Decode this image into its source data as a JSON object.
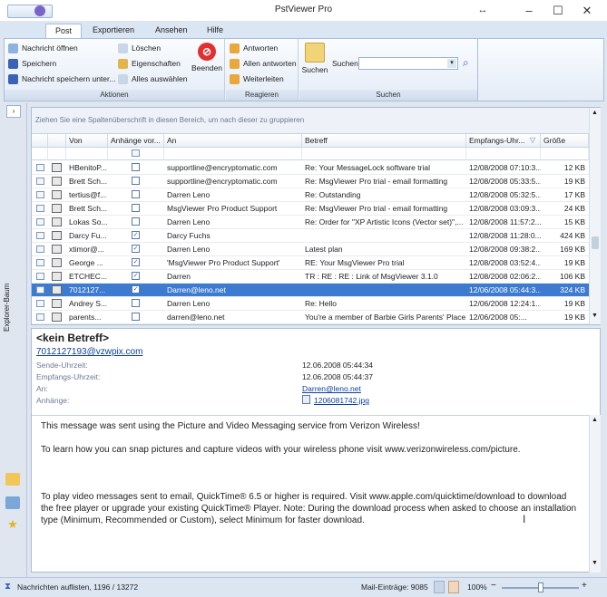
{
  "window": {
    "title": "PstViewer Pro"
  },
  "tabs": [
    "Post",
    "Exportieren",
    "Ansehen",
    "Hilfe"
  ],
  "ribbon": {
    "aktionen": {
      "label": "Aktionen",
      "open": "Nachricht öffnen",
      "save": "Speichern",
      "save_under": "Nachricht speichern unter...",
      "delete": "Löschen",
      "properties": "Eigenschaften",
      "select_all": "Alles auswählen",
      "exit": "Beenden"
    },
    "reagieren": {
      "label": "Reagieren",
      "reply": "Antworten",
      "reply_all": "Allen antworten",
      "forward": "Weiterleiten"
    },
    "suchen": {
      "label": "Suchen",
      "search_button": "Suchen",
      "search_label": "Suchen",
      "search_value": ""
    }
  },
  "leftnav": {
    "title": "Explorer-Baum"
  },
  "grid": {
    "group_hint": "Ziehen Sie eine Spaltenüberschrift in diesen Bereich, um nach dieser zu gruppieren",
    "columns": [
      "Von",
      "Anhänge vor...",
      "An",
      "Betreff",
      "Empfangs-Uhr...",
      "Größe"
    ],
    "rows": [
      {
        "from": "HBenitoP...",
        "att": false,
        "to": "supportline@encryptomatic.com",
        "subject": "Re: Your MessageLock software trial",
        "date": "12/08/2008 07:10:3...",
        "size": "12 KB"
      },
      {
        "from": "Brett Sch...",
        "att": false,
        "to": "supportline@encryptomatic.com",
        "subject": "Re: MsgViewer Pro trial - email formatting",
        "date": "12/08/2008 05:33:5...",
        "size": "19 KB"
      },
      {
        "from": "tertius@f...",
        "att": false,
        "to": "Darren Leno",
        "subject": "Re: Outstanding",
        "date": "12/08/2008 05:32:5...",
        "size": "17 KB"
      },
      {
        "from": "Brett Sch...",
        "att": false,
        "to": "MsgViewer Pro Product Support",
        "subject": "Re: MsgViewer Pro trial - email formatting",
        "date": "12/08/2008 03:09:3...",
        "size": "24 KB"
      },
      {
        "from": "Lokas So...",
        "att": false,
        "to": "Darren Leno",
        "subject": "Re: Order for \"XP Artistic Icons (Vector set)\",...",
        "date": "12/08/2008 11:57:2...",
        "size": "15 KB"
      },
      {
        "from": "Darcy Fu...",
        "att": true,
        "to": "Darcy Fuchs",
        "subject": "",
        "date": "12/08/2008 11:28:0...",
        "size": "424 KB"
      },
      {
        "from": "xtimor@...",
        "att": true,
        "to": "Darren Leno",
        "subject": "Latest plan",
        "date": "12/08/2008 09:38:2...",
        "size": "169 KB"
      },
      {
        "from": "George ...",
        "att": true,
        "to": "'MsgViewer Pro Product Support'",
        "subject": "RE: Your MsgViewer Pro trial",
        "date": "12/08/2008 03:52:4...",
        "size": "19 KB"
      },
      {
        "from": "ETCHEC...",
        "att": true,
        "to": "Darren",
        "subject": "TR : RE : RE : Link of MsgViewer 3.1.0",
        "date": "12/08/2008 02:06:2...",
        "size": "106 KB"
      },
      {
        "from": "7012127...",
        "att": true,
        "to": "Darren@leno.net",
        "subject": "",
        "date": "12/06/2008 05:44:3...",
        "size": "324 KB",
        "selected": true
      },
      {
        "from": "Andrey S...",
        "att": false,
        "to": "Darren Leno",
        "subject": "Re: Hello",
        "date": "12/06/2008 12:24:1...",
        "size": "19 KB"
      },
      {
        "from": "parents...",
        "att": false,
        "to": "darren@leno.net",
        "subject": "You're a member of Barbie Girls Parents' Place!",
        "date": "12/06/2008 05:...",
        "size": "19 KB"
      }
    ]
  },
  "preview": {
    "subject": "<kein Betreff>",
    "sender": "7012127193@vzwpix.com",
    "sent_label": "Sende-Uhrzeit:",
    "sent_value": "12.06.2008 05:44:34",
    "recv_label": "Empfangs-Uhrzeit:",
    "recv_value": "12.06.2008 05:44:37",
    "to_label": "An:",
    "to_value": "Darren@leno.net",
    "att_label": "Anhänge:",
    "att_value": "1206081742.jpg",
    "body": [
      "This message was sent using the Picture and Video Messaging service from Verizon Wireless!",
      "To learn how you can snap pictures and capture videos with your wireless phone visit www.verizonwireless.com/picture.",
      "",
      "To play video messages sent to email, QuickTime® 6.5 or higher is required. Visit www.apple.com/quicktime/download to download the free player or upgrade your existing QuickTime® Player.  Note: During the download process when asked to choose an installation type (Minimum, Recommended or Custom), select Minimum for faster download."
    ]
  },
  "status": {
    "left": "Nachrichten auflisten, 1196 / 13272",
    "mail": "Mail-Einträge: 9085",
    "zoom": "100%",
    "zoom_level": 0.5
  }
}
